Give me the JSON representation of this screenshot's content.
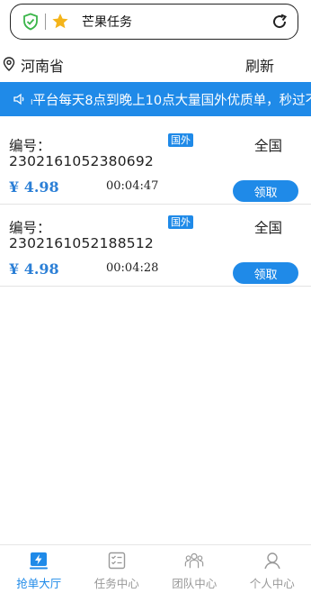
{
  "header": {
    "title": "芒果任务",
    "shield_icon": "shield-check-icon",
    "star_icon": "star-icon",
    "refresh_icon": "refresh-icon"
  },
  "location": {
    "text": "河南省",
    "refresh_label": "刷新",
    "icon": "location-pin-icon"
  },
  "notice": {
    "text": "ₗ平台每天8点到晚上10点大量国外优质单，秒过不",
    "icon": "speaker-icon"
  },
  "tasks": [
    {
      "number_label": "编号：",
      "number": "2302161052380692",
      "badge": "国外",
      "region": "全国",
      "price": "¥ 4.98",
      "timer": "00:04:47",
      "action": "领取"
    },
    {
      "number_label": "编号：",
      "number": "2302161052188512",
      "badge": "国外",
      "region": "全国",
      "price": "¥ 4.98",
      "timer": "00:04:28",
      "action": "领取"
    }
  ],
  "nav": [
    {
      "label": "抢单大厅",
      "icon": "lightning-icon",
      "active": true
    },
    {
      "label": "任务中心",
      "icon": "checklist-icon",
      "active": false
    },
    {
      "label": "团队中心",
      "icon": "team-icon",
      "active": false
    },
    {
      "label": "个人中心",
      "icon": "user-icon",
      "active": false
    }
  ],
  "colors": {
    "accent": "#1f8ae8",
    "price": "#2b7fd6",
    "nav_inactive": "#999999"
  }
}
